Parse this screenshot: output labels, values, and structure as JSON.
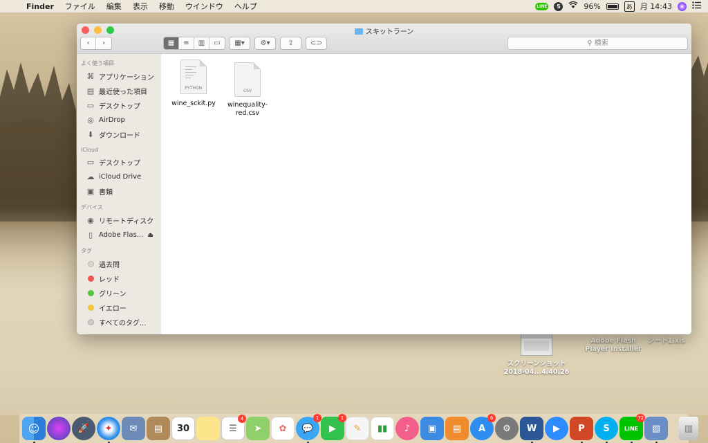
{
  "menubar": {
    "app_name": "Finder",
    "menus": [
      "ファイル",
      "編集",
      "表示",
      "移動",
      "ウインドウ",
      "ヘルプ"
    ],
    "battery": "96%",
    "ime": "あ",
    "clock": "月 14:43",
    "line_badge": "LINE",
    "skype_badge": "S"
  },
  "window": {
    "title": "スキットラーン",
    "search_placeholder": "検索"
  },
  "sidebar": {
    "favorites_header": "よく使う項目",
    "favorites": [
      "アプリケーション",
      "最近使った項目",
      "デスクトップ",
      "AirDrop",
      "ダウンロード"
    ],
    "icloud_header": "iCloud",
    "icloud": [
      "デスクトップ",
      "iCloud Drive",
      "書類"
    ],
    "devices_header": "デバイス",
    "devices": [
      "リモートディスク",
      "Adobe Flas..."
    ],
    "tags_header": "タグ",
    "tags": [
      {
        "label": "過去問",
        "color": "#d8d4ce"
      },
      {
        "label": "レッド",
        "color": "#f0514d"
      },
      {
        "label": "グリーン",
        "color": "#53c13f"
      },
      {
        "label": "イエロー",
        "color": "#f2c530"
      },
      {
        "label": "すべてのタグ...",
        "color": "#cfcac3"
      }
    ]
  },
  "files": [
    {
      "name": "wine_sckit.py",
      "ext": "PYTHON"
    },
    {
      "name_line1": "winequality-",
      "name_line2": "red.csv",
      "ext": "CSV"
    }
  ],
  "desktop": {
    "screenshot_line1": "スクリーンショット",
    "screenshot_line2": "2018-04...4.40.26",
    "adobe_line1": "Adobe Flash",
    "adobe_line2": "Player Installer",
    "sheet": "シート1.xls"
  },
  "dock": {
    "calendar_day": "30",
    "badges": {
      "reminders": "4",
      "messages": "1",
      "facetime": "1",
      "appstore": "6",
      "line": "72"
    }
  }
}
